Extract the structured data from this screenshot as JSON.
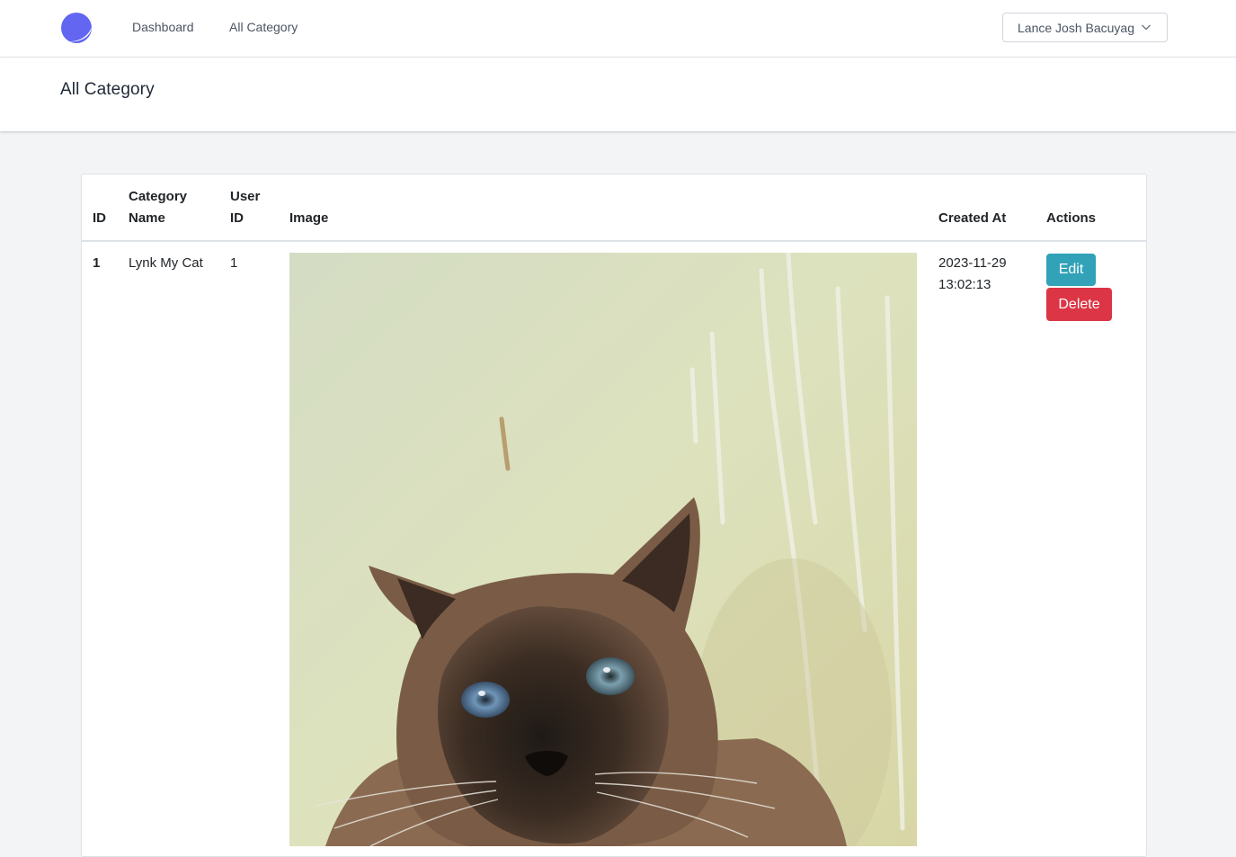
{
  "nav": {
    "logo_icon": "crescent-logo-icon",
    "brand_color": "#6366f1",
    "links": [
      {
        "label": "Dashboard"
      },
      {
        "label": "All Category"
      }
    ],
    "user": {
      "name": "Lance Josh Bacuyag",
      "icon": "chevron-down-icon"
    }
  },
  "header": {
    "title": "All Category"
  },
  "table": {
    "columns": [
      "ID",
      "Category Name",
      "User ID",
      "Image",
      "Created At",
      "Actions"
    ],
    "rows": [
      {
        "id": "1",
        "category_name": "Lynk My Cat",
        "user_id": "1",
        "image": "cat-photo",
        "created_date": "2023-11-29",
        "created_time": "13:02:13",
        "actions": {
          "edit": "Edit",
          "delete": "Delete"
        }
      }
    ]
  },
  "colors": {
    "edit_button": "#31a2b8",
    "delete_button": "#dc3545",
    "page_bg": "#f3f4f6"
  }
}
